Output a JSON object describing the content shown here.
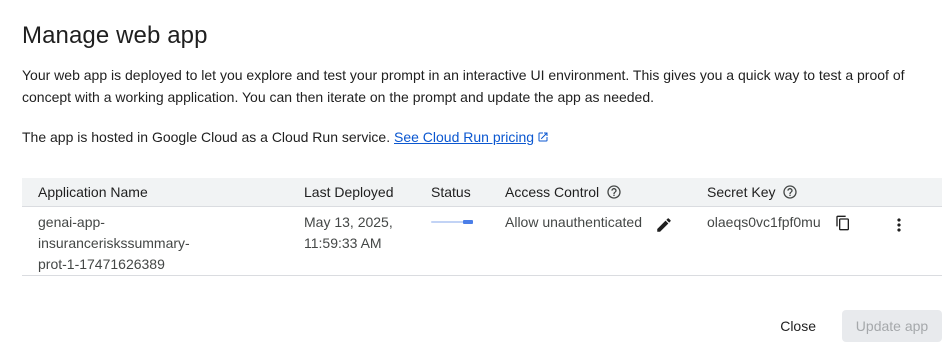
{
  "dialog": {
    "title": "Manage web app",
    "description": "Your web app is deployed to let you explore and test your prompt in an interactive UI environment. This gives you a quick way to test a proof of concept with a working application. You can then iterate on the prompt and update the app as needed.",
    "hosted_text": "The app is hosted in Google Cloud as a Cloud Run service. ",
    "pricing_link": "See Cloud Run pricing",
    "link_color": "#0b57d0"
  },
  "table": {
    "headers": {
      "application_name": "Application Name",
      "last_deployed": "Last Deployed",
      "status": "Status",
      "access_control": "Access Control",
      "secret_key": "Secret Key"
    },
    "rows": [
      {
        "app_name_lines": [
          "genai-app-",
          "insuranceriskssummary-",
          "prot-1-17471626389"
        ],
        "last_deployed_lines": [
          "May 13, 2025,",
          "11:59:33 AM"
        ],
        "status_progress": 0.25,
        "access_control": "Allow unauthenticated",
        "secret_key": "olaeqs0vc1fpf0mu"
      }
    ]
  },
  "footer": {
    "close_label": "Close",
    "update_label": "Update app"
  },
  "icons": {
    "external_link": "open-in-new-icon",
    "help": "help-circle-icon",
    "edit": "pencil-icon",
    "copy": "copy-icon",
    "more": "more-vert-icon"
  }
}
